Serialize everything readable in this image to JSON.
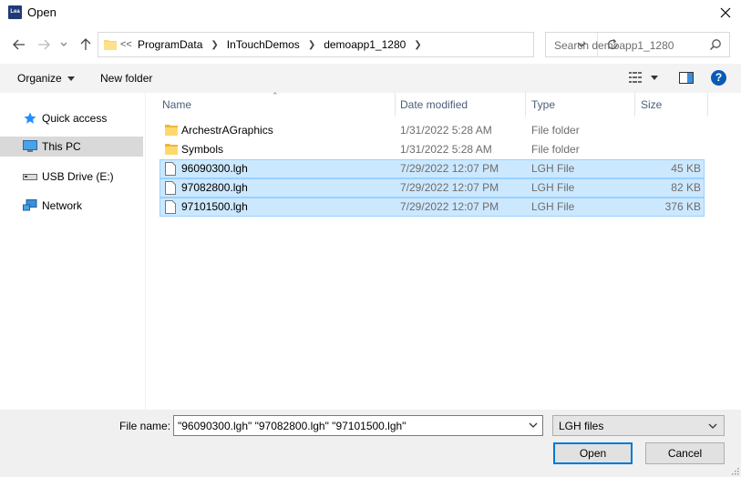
{
  "window": {
    "title": "Open",
    "app_icon_text": "Lea"
  },
  "address": {
    "overflow": "<<",
    "crumbs": [
      "ProgramData",
      "InTouchDemos",
      "demoapp1_1280"
    ]
  },
  "search": {
    "placeholder": "Search demoapp1_1280"
  },
  "toolbar": {
    "organize": "Organize",
    "new_folder": "New folder"
  },
  "sidebar": {
    "items": [
      {
        "label": "Quick access",
        "icon": "star-icon",
        "selected": false
      },
      {
        "label": "This PC",
        "icon": "computer-icon",
        "selected": true
      },
      {
        "label": "USB Drive (E:)",
        "icon": "usb-drive-icon",
        "selected": false
      },
      {
        "label": "Network",
        "icon": "network-icon",
        "selected": false
      }
    ]
  },
  "columns": {
    "name": "Name",
    "date": "Date modified",
    "type": "Type",
    "size": "Size"
  },
  "files": [
    {
      "name": "ArchestrAGraphics",
      "date": "1/31/2022 5:28 AM",
      "type": "File folder",
      "size": "",
      "icon": "folder-icon",
      "selected": false
    },
    {
      "name": "Symbols",
      "date": "1/31/2022 5:28 AM",
      "type": "File folder",
      "size": "",
      "icon": "folder-icon",
      "selected": false
    },
    {
      "name": "96090300.lgh",
      "date": "7/29/2022 12:07 PM",
      "type": "LGH File",
      "size": "45 KB",
      "icon": "file-icon",
      "selected": true
    },
    {
      "name": "97082800.lgh",
      "date": "7/29/2022 12:07 PM",
      "type": "LGH File",
      "size": "82 KB",
      "icon": "file-icon",
      "selected": true
    },
    {
      "name": "97101500.lgh",
      "date": "7/29/2022 12:07 PM",
      "type": "LGH File",
      "size": "376 KB",
      "icon": "file-icon",
      "selected": true
    }
  ],
  "bottom": {
    "file_name_label": "File name:",
    "file_name_value": "\"96090300.lgh\" \"97082800.lgh\" \"97101500.lgh\"",
    "file_type": "LGH files",
    "open": "Open",
    "cancel": "Cancel"
  },
  "colors": {
    "selection": "#cce8ff",
    "selection_border": "#99d1ff",
    "accent": "#0078d7",
    "help": "#0a5bb5"
  }
}
